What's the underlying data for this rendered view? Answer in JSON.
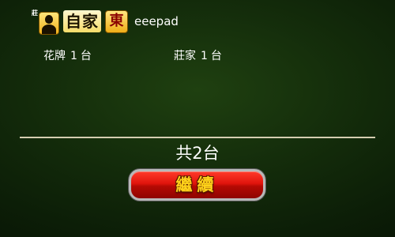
{
  "player": {
    "dealer_mark": "莊",
    "avatar_icon": "player-avatar-icon",
    "self_label": "自家",
    "wind": "東",
    "name": "eeepad"
  },
  "fans": [
    {
      "name": "花牌",
      "value": "1",
      "unit": "台"
    },
    {
      "name": "莊家",
      "value": "1",
      "unit": "台"
    }
  ],
  "total": "共2台",
  "continue_button": {
    "label": "繼續"
  },
  "colors": {
    "table_felt": "#142d0b",
    "badge_gold": "#f2b21c",
    "button_red": "#e0140c",
    "button_text": "#ffd21a",
    "divider": "#d4cdb0"
  }
}
